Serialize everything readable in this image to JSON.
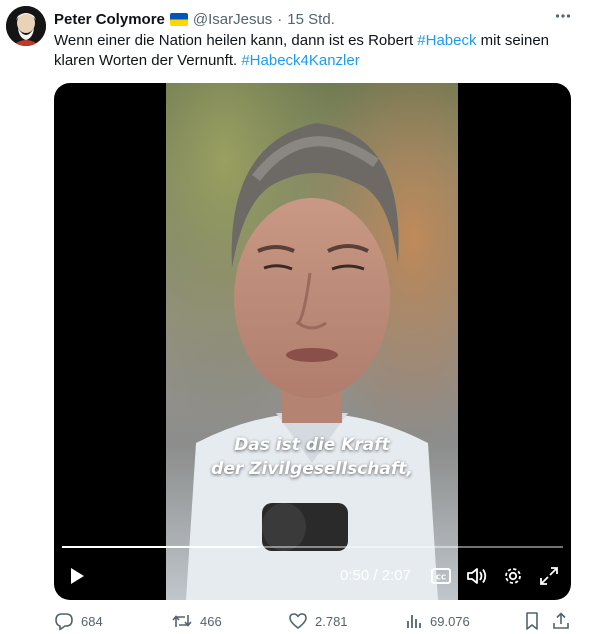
{
  "tweet": {
    "author_name": "Peter Colymore",
    "handle": "@IsarJesus",
    "separator": "·",
    "time": "15 Std.",
    "text_before": "Wenn einer die Nation heilen kann, dann ist es Robert ",
    "hashtag1": "#Habeck",
    "text_middle": " mit seinen klaren Worten der Vernunft. ",
    "hashtag2": "#Habeck4Kanzler"
  },
  "video": {
    "caption_line1": "Das ist die Kraft",
    "caption_line2": "der Zivilgesellschaft,",
    "current_time": "0:50",
    "duration": "2:07",
    "time_display": "0:50 / 2:07",
    "progress_percent": 39.4
  },
  "actions": {
    "replies": "684",
    "reposts": "466",
    "likes": "2.781",
    "views": "69.076"
  },
  "colors": {
    "accent": "#1d9bf0",
    "secondary_text": "#536471",
    "flag_blue": "#0057b7",
    "flag_yellow": "#ffd700"
  }
}
